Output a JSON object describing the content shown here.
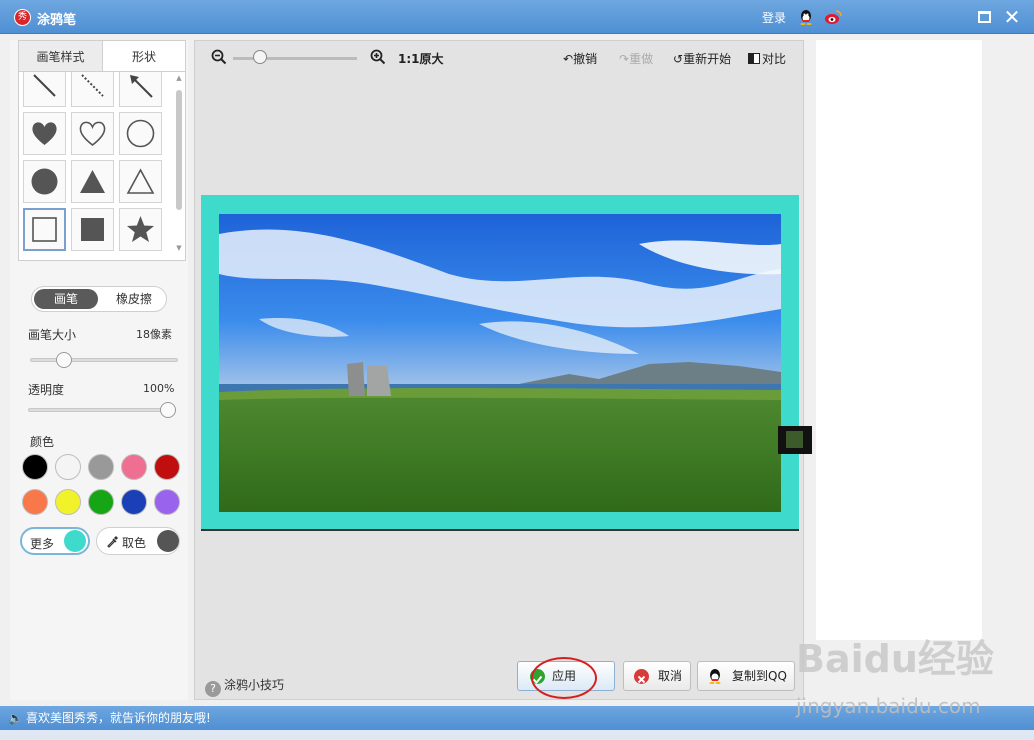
{
  "window": {
    "title": "涂鸦笔",
    "login": "登录",
    "app_icon_text": "秀"
  },
  "left_panel": {
    "tabs": [
      {
        "label": "画笔样式",
        "selected": false
      },
      {
        "label": "形状",
        "selected": true
      }
    ],
    "shapes": [
      "line",
      "dashed-line",
      "arrow",
      "filled-heart",
      "outline-heart",
      "outline-circle",
      "filled-circle",
      "filled-triangle",
      "outline-triangle",
      "outline-square",
      "filled-square",
      "filled-star"
    ],
    "selected_shape": "outline-square",
    "mode": {
      "pen": "画笔",
      "eraser": "橡皮擦",
      "active": "pen"
    },
    "brush_size": {
      "label": "画笔大小",
      "value": "18像素",
      "fraction": 0.2
    },
    "opacity": {
      "label": "透明度",
      "value": "100%",
      "fraction": 1.0
    },
    "color_label": "颜色",
    "colors": [
      "#000000",
      "#f4f4f4",
      "#999999",
      "#ef6f92",
      "#c00e0e",
      "#f9784a",
      "#f2f22b",
      "#16a515",
      "#1a40b8",
      "#9a63ee"
    ],
    "more_label": "更多",
    "current_color": "#3edbcc",
    "picker_label": "取色",
    "picker_color": "#555555"
  },
  "toolbar": {
    "zoom_fraction": 0.18,
    "actual_size": "1:1原大",
    "undo": "撤销",
    "redo": "重做",
    "restart": "重新开始",
    "compare": "对比"
  },
  "bottom": {
    "tips": "涂鸦小技巧",
    "apply": "应用",
    "cancel": "取消",
    "copy_qq": "复制到QQ"
  },
  "status": {
    "message": "喜欢美图秀秀，就告诉你的朋友哦!"
  },
  "watermark": {
    "logo": "Baidu经验",
    "url": "jingyan.baidu.com"
  }
}
